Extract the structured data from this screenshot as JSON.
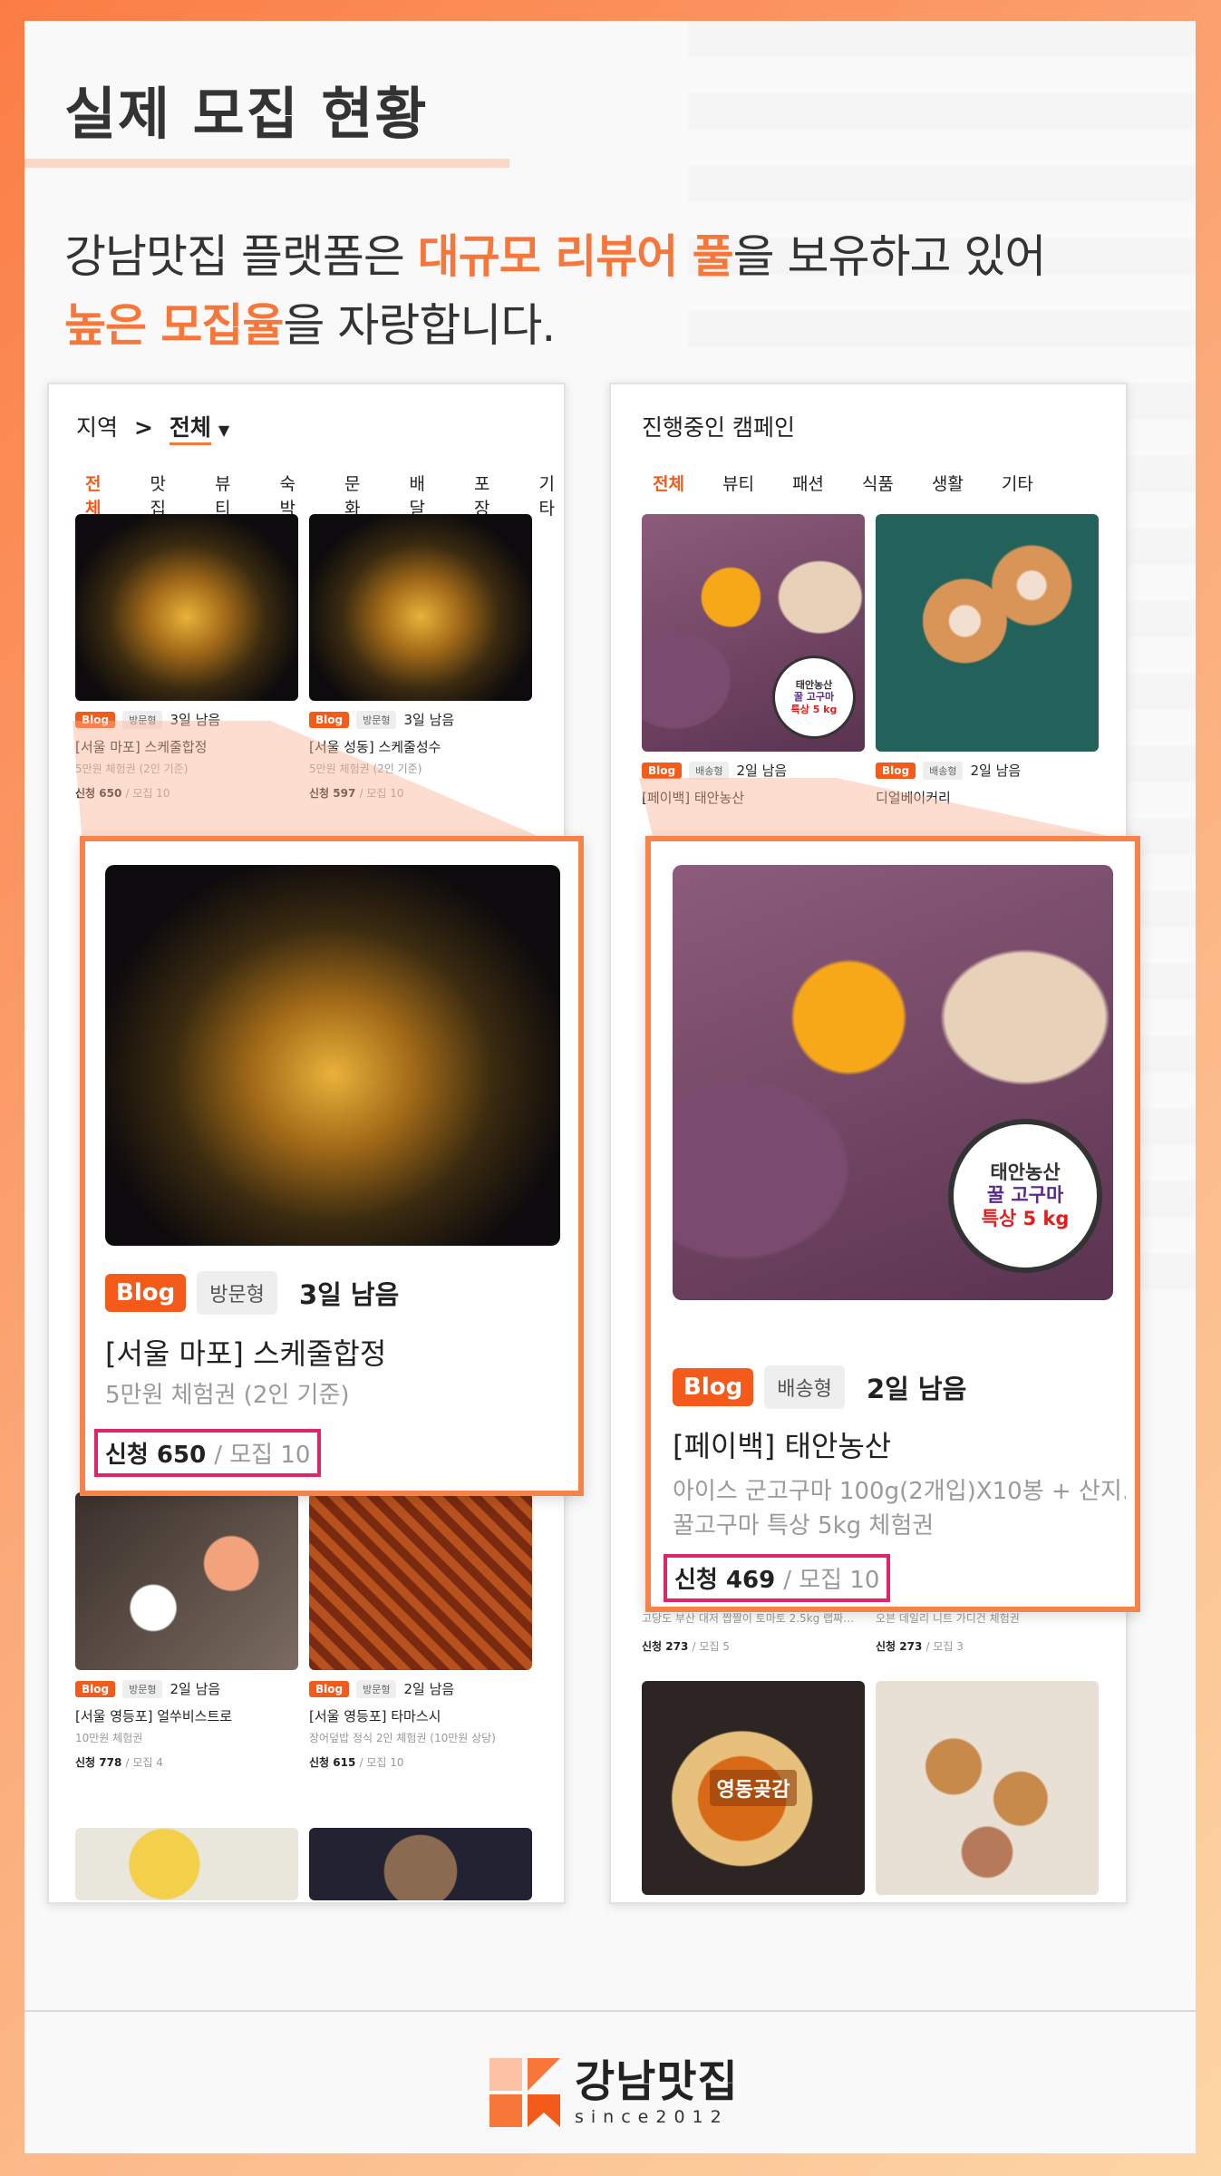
{
  "header": {
    "title": "실제 모집 현황",
    "intro_part1": "강남맛집 플랫폼은 ",
    "intro_hl1": "대규모 리뷰어 풀",
    "intro_part2": "을 보유하고 있어",
    "intro_hl2": "높은 모집율",
    "intro_part3": "을 자랑합니다."
  },
  "left": {
    "region_label": "지역",
    "separator": ">",
    "region_value": "전체",
    "tabs": [
      "전체",
      "맛집",
      "뷰티",
      "숙박",
      "문화",
      "배달",
      "포장",
      "기타"
    ],
    "cards": [
      {
        "badge": "Blog",
        "type": "방문형",
        "days": "3일 남음",
        "title": "[서울 마포] 스케줄합정",
        "sub": "5만원 체험권 (2인 기준)",
        "count_label": "신청 650",
        "cap": "/ 모집 10"
      },
      {
        "badge": "Blog",
        "type": "방문형",
        "days": "3일 남음",
        "title": "[서울 성동] 스케줄성수",
        "sub": "5만원 체험권 (2인 기준)",
        "count_label": "신청 597",
        "cap": "/ 모집 10"
      },
      {
        "badge": "Blog",
        "type": "방문형",
        "days": "2일 남음",
        "title": "[서울 영등포] 얼쑤비스트로",
        "sub": "10만원 체험권",
        "count_label": "신청 778",
        "cap": "/ 모집 4"
      },
      {
        "badge": "Blog",
        "type": "방문형",
        "days": "2일 남음",
        "title": "[서울 영등포] 타마스시",
        "sub": "장어덮밥 정식 2인 체험권 (10만원 상당)",
        "count_label": "신청 615",
        "cap": "/ 모집 10"
      }
    ],
    "zoom": {
      "badge": "Blog",
      "type": "방문형",
      "days": "3일 남음",
      "title": "[서울 마포] 스케줄합정",
      "sub": "5만원 체험권 (2인 기준)",
      "count_label": "신청 650",
      "cap": "/ 모집 10"
    }
  },
  "right": {
    "title": "진행중인 캠페인",
    "tabs": [
      "전체",
      "뷰티",
      "패션",
      "식품",
      "생활",
      "기타"
    ],
    "cards": [
      {
        "badge": "Blog",
        "type": "배송형",
        "days": "2일 남음",
        "title": "[페이백] 태안농산"
      },
      {
        "badge": "Blog",
        "type": "배송형",
        "days": "2일 남음",
        "title": "디얼베이커리"
      }
    ],
    "hidden_row": [
      {
        "sub": "고당도 부산 대저 짭짤이 토마토 2.5kg 랩짜…",
        "count_label": "신청 273",
        "cap": "/ 모집 5"
      },
      {
        "sub": "오븐 데일리 니트 가디건 체험권",
        "count_label": "신청 273",
        "cap": "/ 모집 3"
      }
    ],
    "zoom": {
      "badge": "Blog",
      "type": "배송형",
      "days": "2일 남음",
      "title": "[페이백] 태안농산",
      "sub1": "아이스 군고구마 100g(2개입)X10봉 + 산지…",
      "sub2": "꿀고구마 특상 5kg 체험권",
      "count_label": "신청 469",
      "cap": "/ 모집 10"
    },
    "stamp": {
      "line1": "태안농산",
      "line2": "꿀 고구마",
      "line3": "특상 5 kg"
    },
    "persimmon_label": "영동곶감"
  },
  "footer": {
    "logo_name": "강남맛집",
    "since": "since2012"
  },
  "colors": {
    "accent": "#f45a1a",
    "highlight": "#f7773a",
    "count_box": "#e0266a",
    "zoom_border": "#f7834b"
  }
}
